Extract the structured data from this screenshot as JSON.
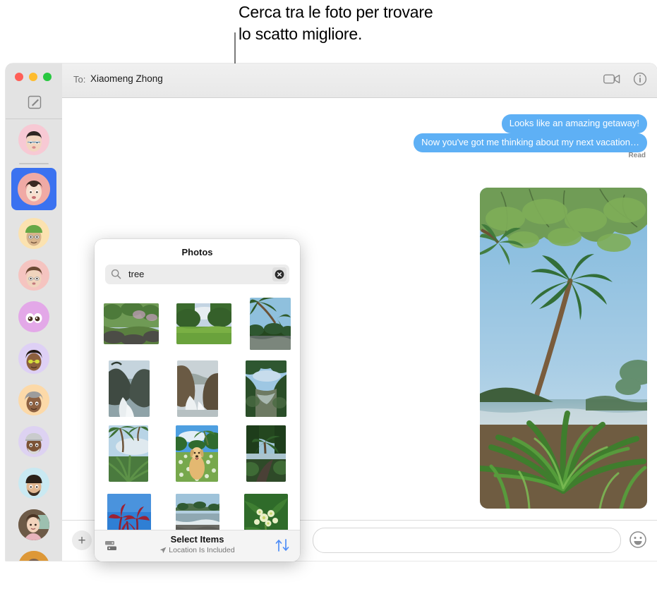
{
  "callout": {
    "line1": "Cerca tra le foto per trovare",
    "line2": "lo scatto migliore."
  },
  "window": {
    "titlebar": {
      "to_label": "To:",
      "recipient": "Xiaomeng Zhong",
      "facetime_icon": "video-camera-icon",
      "details_icon": "info-circle-icon"
    },
    "sidebar": {
      "traffic_lights": [
        {
          "name": "close",
          "color": "#ff5f57"
        },
        {
          "name": "minimize",
          "color": "#febc2e"
        },
        {
          "name": "maximize",
          "color": "#28c840"
        }
      ],
      "compose_icon": "compose-icon",
      "conversations": [
        {
          "id": "conv-1",
          "avatar": "memoji-woman-glasses",
          "bg": "#f7c9d4",
          "selected": false
        },
        {
          "id": "conv-2",
          "avatar": "memoji-woman-bob",
          "bg": "#f0aaa5",
          "selected": true
        },
        {
          "id": "conv-3",
          "avatar": "memoji-green-cap",
          "bg": "#fbe2b0",
          "selected": false
        },
        {
          "id": "conv-4",
          "avatar": "memoji-woman-glasses-2",
          "bg": "#f5c4c0",
          "selected": false
        },
        {
          "id": "conv-5",
          "avatar": "memoji-eyes",
          "bg": "#e3a8e8",
          "selected": false
        },
        {
          "id": "conv-6",
          "avatar": "memoji-yellow-glasses",
          "bg": "#ded0f5",
          "selected": false
        },
        {
          "id": "conv-7",
          "avatar": "memoji-grey-hair",
          "bg": "#fcd9a8",
          "selected": false
        },
        {
          "id": "conv-8",
          "avatar": "memoji-beanie-beard",
          "bg": "#ddd2f2",
          "selected": false
        },
        {
          "id": "conv-9",
          "avatar": "memoji-beard-cap",
          "bg": "#c9e9f2",
          "selected": false
        },
        {
          "id": "conv-10",
          "avatar": "photo-person-smiling",
          "bg": "#7d6a55",
          "selected": false
        },
        {
          "id": "conv-11",
          "avatar": "photo-person-partial",
          "bg": "#e09a3c",
          "selected": false
        }
      ]
    },
    "conversation": {
      "messages": [
        {
          "text": "Looks like an amazing getaway!",
          "from": "me"
        },
        {
          "text": "Now you've got me thinking about my next vacation…",
          "from": "me"
        }
      ],
      "read_status": "Read",
      "attachment": {
        "name": "palm-trees-photo",
        "alt": "Palm trees and tropical plants by the ocean"
      }
    },
    "composer": {
      "add_button": "+",
      "message_value": "",
      "message_placeholder": "",
      "emoji_icon": "emoji-smiley-icon"
    }
  },
  "photos_popover": {
    "title": "Photos",
    "search": {
      "value": "tree",
      "placeholder": "Search",
      "icon": "search-icon",
      "clear_icon": "clear-circle-icon"
    },
    "grid": [
      [
        {
          "name": "photo-forest-rocks",
          "w": 78,
          "h": 58,
          "sky": "#b9cfd8",
          "land": "#4d7a3a",
          "kind": "forest"
        },
        {
          "name": "photo-green-meadow",
          "w": 78,
          "h": 58,
          "sky": "#c3d4e2",
          "land": "#6aa23c",
          "kind": "meadow"
        },
        {
          "name": "photo-palm-river",
          "w": 58,
          "h": 74,
          "sky": "#8fc0dd",
          "land": "#2f5a2a",
          "kind": "palm"
        }
      ],
      [
        {
          "name": "photo-cliff-coast",
          "w": 58,
          "h": 80,
          "sky": "#c5d4dd",
          "land": "#3f4a42",
          "kind": "cliff"
        },
        {
          "name": "photo-sea-rocks",
          "w": 58,
          "h": 80,
          "sky": "#c9d2d6",
          "land": "#5a4b3c",
          "kind": "cliff"
        },
        {
          "name": "photo-jungle-stream",
          "w": 58,
          "h": 80,
          "sky": "#9ec7e3",
          "land": "#2e5730",
          "kind": "stream"
        }
      ],
      [
        {
          "name": "photo-palm-sky",
          "w": 56,
          "h": 80,
          "sky": "#b8d4e6",
          "land": "#4a7a3e",
          "kind": "palm"
        },
        {
          "name": "photo-dog-flowers",
          "w": 60,
          "h": 80,
          "sky": "#4e9fe0",
          "land": "#77a84c",
          "kind": "dog"
        },
        {
          "name": "photo-palm-path",
          "w": 56,
          "h": 80,
          "sky": "#9ec4d6",
          "land": "#24471f",
          "kind": "path"
        }
      ],
      [
        {
          "name": "photo-red-leaves-sky",
          "w": 62,
          "h": 70,
          "sky": "#2f7fd4",
          "land": "#8d2030",
          "kind": "leaves"
        },
        {
          "name": "photo-beach-shore",
          "w": 62,
          "h": 70,
          "sky": "#b3cfe0",
          "land": "#5a5a56",
          "kind": "beach"
        },
        {
          "name": "photo-white-flower",
          "w": 62,
          "h": 70,
          "sky": "#2f6b2a",
          "land": "#e9efc6",
          "kind": "flower"
        }
      ]
    ],
    "footer": {
      "title": "Select Items",
      "subtitle": "Location Is Included",
      "location_icon": "location-arrow-icon",
      "left_icon": "photo-stack-icon",
      "sort_icon": "sort-arrows-icon",
      "sort_color": "#4f8ef7"
    }
  }
}
